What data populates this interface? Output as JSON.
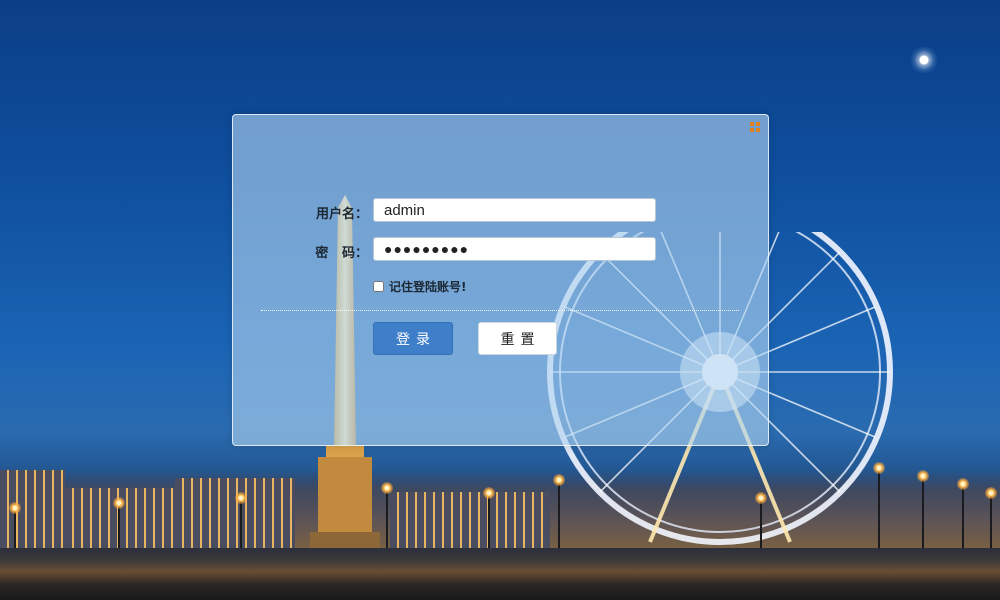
{
  "login": {
    "username_label": "用户名：",
    "username_value": "admin",
    "password_label": "密   码：",
    "password_mask": "●●●●●●●●●",
    "remember_label": "记住登陆账号!",
    "remember_checked": false,
    "login_button": "登录",
    "reset_button": "重置",
    "corner_icon": "grid-icon"
  },
  "colors": {
    "accent": "#3f7fca",
    "corner_icon": "#e2801c",
    "panel": "rgba(176,212,240,0.62)"
  }
}
